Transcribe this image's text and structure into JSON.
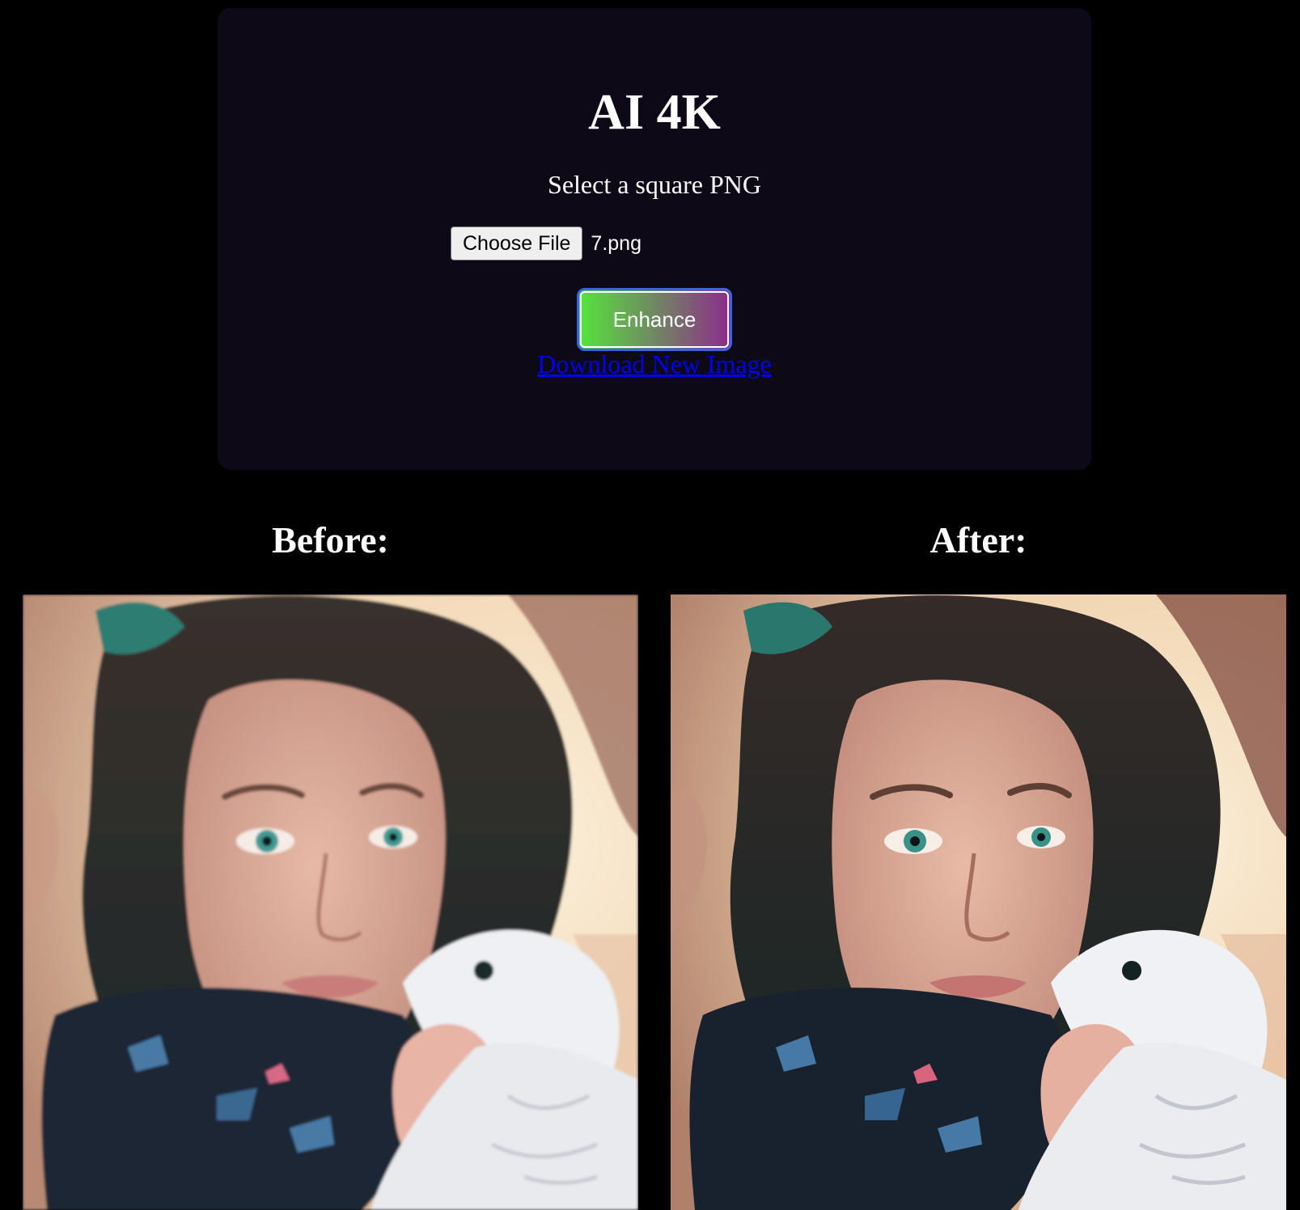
{
  "app": {
    "title": "AI 4K",
    "subtitle": "Select a square PNG"
  },
  "file_input": {
    "button_label": "Choose File",
    "file_name": "7.png"
  },
  "actions": {
    "enhance_label": "Enhance",
    "download_label": "Download New Image"
  },
  "comparison": {
    "before_label": "Before:",
    "after_label": "After:"
  },
  "images": {
    "before_alt": "Illustrated portrait of a woman with dark teal-tinted hair holding a sleeping baby in a white fluffy hood",
    "after_alt": "Enhanced version of the illustrated portrait of a woman holding a sleeping baby"
  },
  "colors": {
    "page_background": "#000000",
    "panel_background": "#0d0916",
    "enhance_gradient_start": "#55e43c",
    "enhance_gradient_end": "#8d2c8a",
    "link_color": "#0000ee"
  }
}
